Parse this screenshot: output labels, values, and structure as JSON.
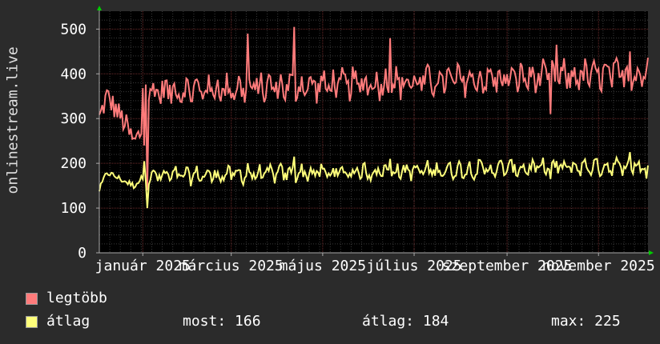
{
  "chart_data": {
    "type": "line",
    "ylabel": "onlinestream.live",
    "ylim": [
      0,
      540
    ],
    "yticks": [
      0,
      100,
      200,
      300,
      400,
      500
    ],
    "x_range": [
      "2024-12-03",
      "2025-12-04"
    ],
    "xticks": [
      {
        "label": "január 2025",
        "date": "2025-01-01"
      },
      {
        "label": "március 2025",
        "date": "2025-03-01"
      },
      {
        "label": "május 2025",
        "date": "2025-05-01"
      },
      {
        "label": "július 2025",
        "date": "2025-07-01"
      },
      {
        "label": "szeptember 2025",
        "date": "2025-09-01"
      },
      {
        "label": "november 2025",
        "date": "2025-11-01"
      }
    ],
    "series": [
      {
        "name": "legtöbb",
        "color": "#ff7b7b"
      },
      {
        "name": "átlag",
        "color": "#ffff7b"
      }
    ],
    "baseline": {
      "start": [
        {
          "date": "2024-12-03",
          "max": 300,
          "avg": 140
        },
        {
          "date": "2024-12-08",
          "max": 350,
          "avg": 180
        },
        {
          "date": "2024-12-14",
          "max": 320,
          "avg": 170
        },
        {
          "date": "2024-12-20",
          "max": 290,
          "avg": 160
        },
        {
          "date": "2024-12-26",
          "max": 245,
          "avg": 150
        },
        {
          "date": "2024-12-31",
          "max": 270,
          "avg": 165
        }
      ],
      "max_level": 375,
      "avg_level": 175,
      "max_trend": [
        360,
        400
      ],
      "avg_trend": [
        170,
        195
      ],
      "max_noise": 28,
      "avg_noise": 14
    },
    "notable_points": [
      {
        "date": "2025-01-04",
        "max": 140,
        "avg": 100
      },
      {
        "date": "2025-01-02",
        "max": 240,
        "avg": 205
      },
      {
        "date": "2025-04-12",
        "max": 505,
        "avg": 215
      },
      {
        "date": "2025-03-12",
        "max": 490,
        "avg": 200
      },
      {
        "date": "2025-06-15",
        "max": 480,
        "avg": 210
      },
      {
        "date": "2025-09-30",
        "max": 310,
        "avg": 165
      },
      {
        "date": "2025-10-04",
        "max": 465,
        "avg": 205
      },
      {
        "date": "2025-11-22",
        "max": 450,
        "avg": 225
      },
      {
        "date": "2025-12-03",
        "max": 410,
        "avg": 166
      }
    ]
  },
  "legend": {
    "max_label": "legtöbb",
    "avg_label": "átlag",
    "now_label": "most: 166",
    "average_label": "átlag: 184",
    "peak_label": "max: 225"
  }
}
